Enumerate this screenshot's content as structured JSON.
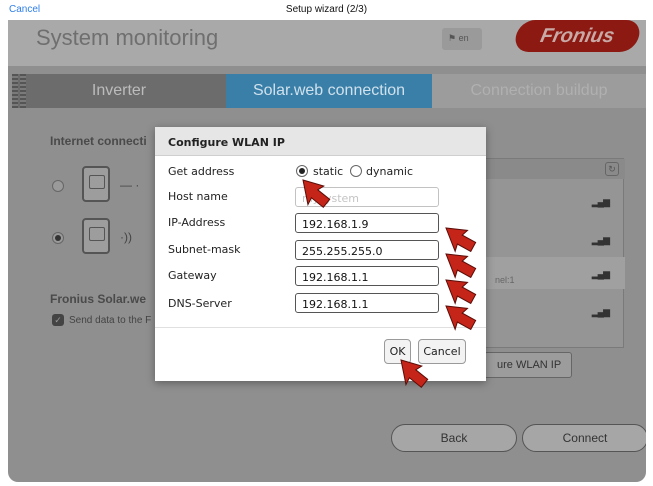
{
  "topbar": {
    "cancel_label": "Cancel",
    "title": "Setup wizard (2/3)"
  },
  "app": {
    "title": "System monitoring",
    "language": "en",
    "brand": "Fronius",
    "steps": [
      "Inverter",
      "Solar.web connection",
      "Connection buildup"
    ],
    "internet_label": "Internet connecti",
    "solarweb_label": "Fronius Solar.we",
    "send_data_label": "Send data to the F",
    "channel_text": "nel:1",
    "configure_wlan_button": "ure WLAN IP",
    "back_button": "Back",
    "connect_button": "Connect"
  },
  "dialog": {
    "title": "Configure WLAN IP",
    "get_address_label": "Get address",
    "option_static": "static",
    "option_dynamic": "dynamic",
    "selected_option": "static",
    "host_name_label": "Host name",
    "host_name_value": "mysystem",
    "ip_label": "IP-Address",
    "ip_value": "192.168.1.9",
    "subnet_label": "Subnet-mask",
    "subnet_value": "255.255.255.0",
    "gateway_label": "Gateway",
    "gateway_value": "192.168.1.1",
    "dns_label": "DNS-Server",
    "dns_value": "192.168.1.1",
    "ok_button": "OK",
    "cancel_button": "Cancel"
  },
  "colors": {
    "accent_blue": "#3a7fa8",
    "brand_red": "#c0281c",
    "ios_link": "#2f7fe8"
  }
}
